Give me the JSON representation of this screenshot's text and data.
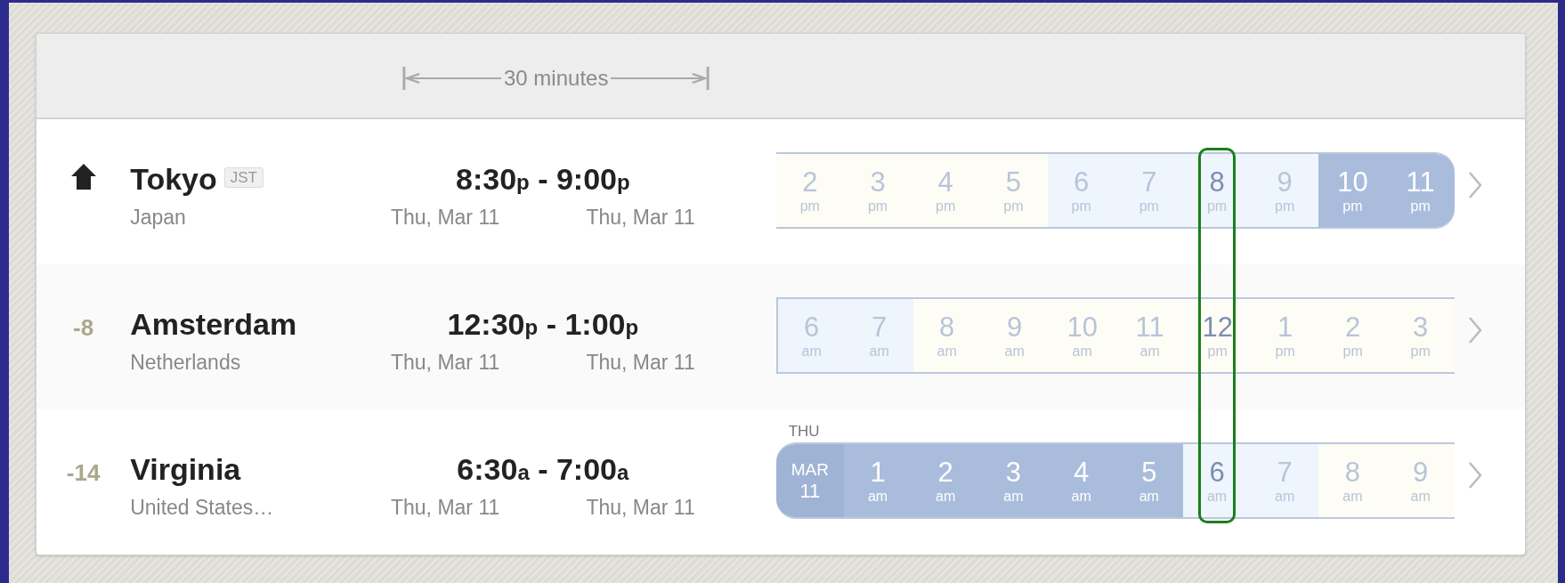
{
  "header": {
    "span_label": "30 minutes"
  },
  "rows": [
    {
      "marker": {
        "kind": "home"
      },
      "city": "Tokyo",
      "tz_badge": "JST",
      "country": "Japan",
      "start": {
        "time": "8:30",
        "suffix": "p",
        "date": "Thu, Mar 11"
      },
      "separator": "-",
      "end": {
        "time": "9:00",
        "suffix": "p",
        "date": "Thu, Mar 11"
      },
      "timeline": {
        "hours": [
          {
            "kind": "day",
            "hour": "2",
            "period": "pm",
            "selected": false
          },
          {
            "kind": "day",
            "hour": "3",
            "period": "pm",
            "selected": false
          },
          {
            "kind": "day",
            "hour": "4",
            "period": "pm",
            "selected": false
          },
          {
            "kind": "day",
            "hour": "5",
            "period": "pm",
            "selected": false
          },
          {
            "kind": "twilight",
            "hour": "6",
            "period": "pm",
            "selected": false
          },
          {
            "kind": "twilight",
            "hour": "7",
            "period": "pm",
            "selected": false
          },
          {
            "kind": "twilight",
            "hour": "8",
            "period": "pm",
            "selected": true
          },
          {
            "kind": "twilight",
            "hour": "9",
            "period": "pm",
            "selected": false
          },
          {
            "kind": "night",
            "hour": "10",
            "period": "pm",
            "selected": false
          },
          {
            "kind": "night",
            "hour": "11",
            "period": "pm",
            "selected": false
          }
        ]
      }
    },
    {
      "marker": {
        "kind": "offset",
        "text": "-8"
      },
      "city": "Amsterdam",
      "country": "Netherlands",
      "start": {
        "time": "12:30",
        "suffix": "p",
        "date": "Thu, Mar 11"
      },
      "separator": "-",
      "end": {
        "time": "1:00",
        "suffix": "p",
        "date": "Thu, Mar 11"
      },
      "timeline": {
        "hours": [
          {
            "kind": "twilight",
            "hour": "6",
            "period": "am",
            "selected": false
          },
          {
            "kind": "twilight",
            "hour": "7",
            "period": "am",
            "selected": false
          },
          {
            "kind": "day",
            "hour": "8",
            "period": "am",
            "selected": false
          },
          {
            "kind": "day",
            "hour": "9",
            "period": "am",
            "selected": false
          },
          {
            "kind": "day",
            "hour": "10",
            "period": "am",
            "selected": false
          },
          {
            "kind": "day",
            "hour": "11",
            "period": "am",
            "selected": false
          },
          {
            "kind": "day",
            "hour": "12",
            "period": "pm",
            "selected": true
          },
          {
            "kind": "day",
            "hour": "1",
            "period": "pm",
            "selected": false
          },
          {
            "kind": "day",
            "hour": "2",
            "period": "pm",
            "selected": false
          },
          {
            "kind": "day",
            "hour": "3",
            "period": "pm",
            "selected": false
          }
        ]
      }
    },
    {
      "marker": {
        "kind": "offset",
        "text": "-14"
      },
      "city": "Virginia",
      "country": "United States…",
      "start": {
        "time": "6:30",
        "suffix": "a",
        "date": "Thu, Mar 11"
      },
      "separator": "-",
      "end": {
        "time": "7:00",
        "suffix": "a",
        "date": "Thu, Mar 11"
      },
      "timeline": {
        "day_label": "THU",
        "hours": [
          {
            "kind": "date",
            "month": "MAR",
            "day": "11",
            "selected": false
          },
          {
            "kind": "night",
            "hour": "1",
            "period": "am",
            "selected": false
          },
          {
            "kind": "night",
            "hour": "2",
            "period": "am",
            "selected": false
          },
          {
            "kind": "night",
            "hour": "3",
            "period": "am",
            "selected": false
          },
          {
            "kind": "night",
            "hour": "4",
            "period": "am",
            "selected": false
          },
          {
            "kind": "night",
            "hour": "5",
            "period": "am",
            "selected": false
          },
          {
            "kind": "twilight",
            "hour": "6",
            "period": "am",
            "selected": true
          },
          {
            "kind": "twilight",
            "hour": "7",
            "period": "am",
            "selected": false
          },
          {
            "kind": "day",
            "hour": "8",
            "period": "am",
            "selected": false
          },
          {
            "kind": "day",
            "hour": "9",
            "period": "am",
            "selected": false
          }
        ]
      }
    }
  ]
}
